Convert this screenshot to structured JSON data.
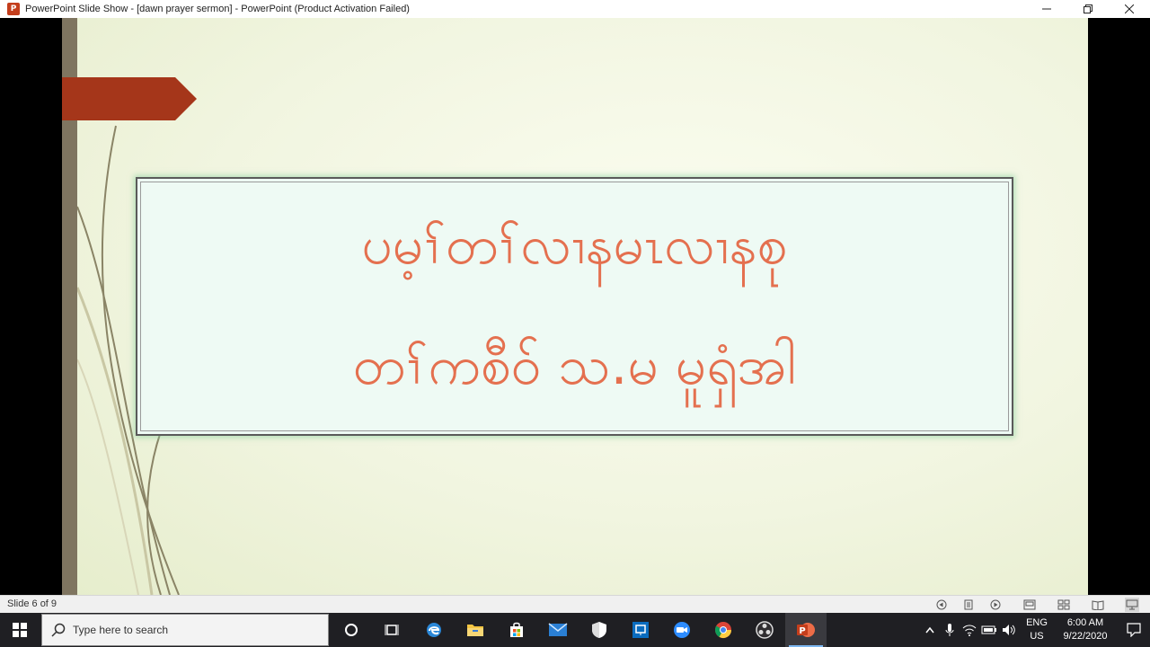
{
  "window": {
    "title": "PowerPoint Slide Show - [dawn prayer sermon] - PowerPoint (Product Activation Failed)",
    "app_icon_letter": "P",
    "controls": [
      "minimize-icon",
      "restore-icon",
      "close-icon"
    ]
  },
  "slide": {
    "line1": "ပမ့ၢ်တၢ်လၢနမၤလၢနစု",
    "line2": "တၢ်ကစီဝ် သ.မ မူရှံအါ",
    "colors": {
      "text": "#e4704f",
      "banner": "#a5361a",
      "bar": "#7f7560"
    }
  },
  "statusbar": {
    "slide_counter": "Slide 6 of 9",
    "icons": [
      "previous-icon",
      "slide-menu-icon",
      "next-icon",
      "normal-view-icon",
      "slide-sorter-icon",
      "reading-view-icon",
      "slideshow-icon"
    ]
  },
  "taskbar": {
    "search_placeholder": "Type here to search",
    "apps": [
      "cortana-icon",
      "task-view-icon",
      "edge-icon",
      "file-explorer-icon",
      "store-icon",
      "mail-icon",
      "security-icon",
      "remote-desktop-icon",
      "zoom-icon",
      "chrome-icon",
      "obs-icon",
      "powerpoint-icon"
    ],
    "active_app": "powerpoint-icon",
    "language_top": "ENG",
    "language_bottom": "US",
    "time": "6:00 AM",
    "date": "9/22/2020"
  }
}
